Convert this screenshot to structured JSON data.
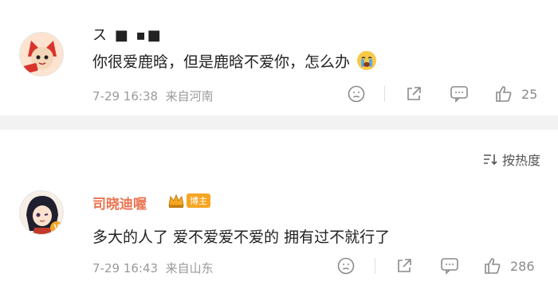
{
  "comment1": {
    "username_visible": "ス ■ ▪■",
    "text": "你很爱鹿晗，但是鹿晗不爱你，怎么办",
    "emoji": "crying-face",
    "time": "7-29 16:38",
    "location": "来自河南",
    "likes": "25"
  },
  "sort": {
    "label": "按热度"
  },
  "comment2": {
    "username": "司晓迪喔",
    "badge": "博主",
    "text": "多大的人了 爱不爱爱不爱的 拥有过不就行了",
    "time": "7-29 16:43",
    "location": "来自山东",
    "likes": "286"
  },
  "colors": {
    "username": "#eb7350",
    "meta": "#9a9a9a",
    "divider": "#f2f2f2",
    "badge": "#f5a623"
  }
}
